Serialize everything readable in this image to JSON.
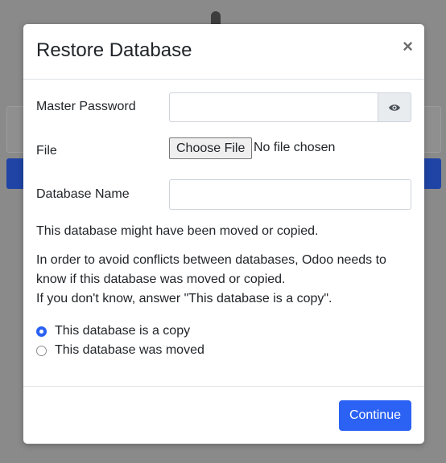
{
  "modal": {
    "title": "Restore Database",
    "close_label": "×",
    "master_password_label": "Master Password",
    "file_label": "File",
    "file_button_label": "Choose File",
    "file_status": "No file chosen",
    "database_name_label": "Database Name",
    "moved_notice": "This database might have been moved or copied.",
    "conflict_line1": "In order to avoid conflicts between databases, Odoo needs to",
    "conflict_line2": "know if this database was moved or copied.",
    "conflict_line3": "If you don't know, answer \"This database is a copy\".",
    "option_copy": "This database is a copy",
    "option_moved": "This database was moved",
    "selected_option": "copy",
    "continue_label": "Continue"
  },
  "colors": {
    "accent": "#2b62f3",
    "overlay": "#8a8a8a"
  },
  "icons": {
    "show_password": "eye-icon"
  }
}
